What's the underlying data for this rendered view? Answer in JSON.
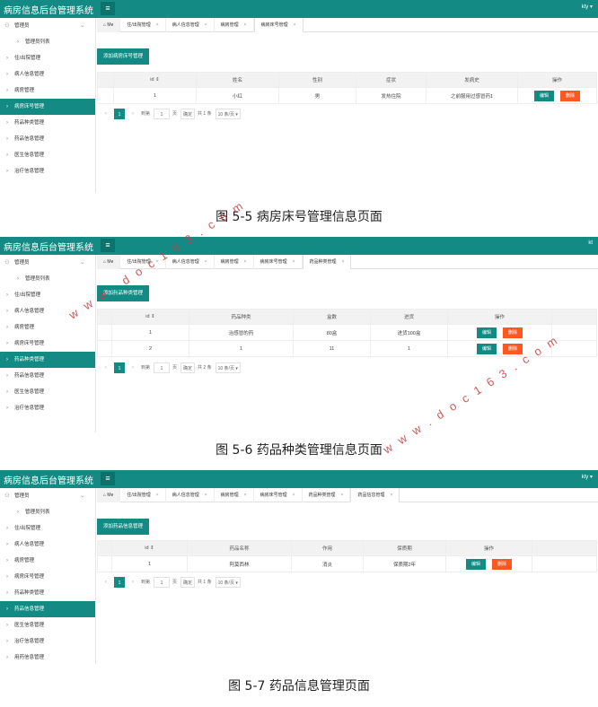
{
  "app_title": "病房信息后台管理系统",
  "user": "kty",
  "user_sparse": "kt",
  "menu_icon_glyph": "≡",
  "home_tab": "Me",
  "sidebar": {
    "admin": "管理员",
    "admin_list": "管理员列表",
    "items": [
      "住/出院管理",
      "病人信息管理",
      "病房管理",
      "病房床号管理",
      "药品种类管理",
      "药品信息管理",
      "医生信息管理",
      "治疗信息管理",
      "用药信息管理"
    ]
  },
  "tabs": [
    "住/出院管理",
    "病人信息管理",
    "病房管理",
    "病房床号管理",
    "药品种类管理",
    "药品信息管理"
  ],
  "pager": {
    "prev": "<",
    "next": ">",
    "page": "1",
    "goto": "到第",
    "page_unit": "页",
    "confirm": "确定",
    "per_page": "10 条/页 ▾"
  },
  "panels": [
    {
      "add_button": "添加病房床号管理",
      "columns": [
        "id ⇕",
        "姓名",
        "性别",
        "症状",
        "发病史",
        "操作"
      ],
      "rows": [
        [
          "1",
          "小红",
          "男",
          "发热住院",
          "之前服用过感冒药1"
        ]
      ],
      "total": "共 1 条",
      "caption": "图 5-5 病房床号管理信息页面"
    },
    {
      "add_button": "添加药品种类管理",
      "columns": [
        "id ⇕",
        "药品种类",
        "盒数",
        "进货",
        "操作"
      ],
      "rows": [
        [
          "1",
          "治感冒的药",
          "80盒",
          "进货100盒"
        ],
        [
          "2",
          "1",
          "11",
          "1"
        ]
      ],
      "total": "共 2 条",
      "caption": "图 5-6 药品种类管理信息页面"
    },
    {
      "add_button": "添加药品信息管理",
      "columns": [
        "id ⇕",
        "药品名称",
        "作用",
        "保质期",
        "操作"
      ],
      "rows": [
        [
          "1",
          "阿莫西林",
          "消炎",
          "保质期2年"
        ]
      ],
      "total": "共 1 条",
      "caption": "图 5-7 药品信息管理页面"
    }
  ],
  "actions": {
    "edit": "编辑",
    "delete": "删除"
  },
  "watermark": "w w w . d o c 1 6 3 . c o m"
}
